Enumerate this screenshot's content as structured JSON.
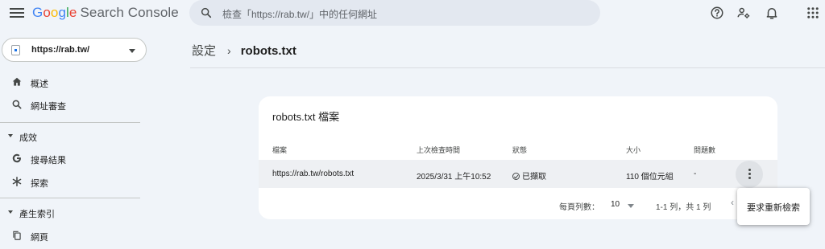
{
  "header": {
    "logo": {
      "g": "G",
      "o1": "o",
      "o2": "o",
      "g2": "g",
      "l": "l",
      "e": "e",
      "product": "Search Console"
    },
    "search_placeholder": "檢查「https://rab.tw/」中的任何網址",
    "icons": [
      "menu-icon",
      "search-icon",
      "help-icon",
      "manage-users-icon",
      "notifications-icon",
      "apps-grid-icon"
    ]
  },
  "sidebar": {
    "property": "https://rab.tw/",
    "items": [
      {
        "label": "概述",
        "icon": "home-icon"
      },
      {
        "label": "網址審查",
        "icon": "search-icon"
      }
    ],
    "sections": [
      {
        "label": "成效",
        "items": [
          {
            "label": "搜尋結果",
            "icon": "google-g-icon"
          },
          {
            "label": "探索",
            "icon": "asterisk-icon"
          }
        ]
      },
      {
        "label": "產生索引",
        "items": [
          {
            "label": "網頁",
            "icon": "pages-icon"
          }
        ]
      }
    ]
  },
  "breadcrumb": {
    "parent": "設定",
    "separator": "›",
    "current": "robots.txt"
  },
  "card": {
    "title": "robots.txt 檔案",
    "columns": [
      "檔案",
      "上次檢查時間",
      "狀態",
      "大小",
      "問題數"
    ],
    "rows": [
      {
        "file": "https://rab.tw/robots.txt",
        "checked": "2025/3/31 上午10:52",
        "status": "已擷取",
        "size": "110 個位元組",
        "issues": "-"
      }
    ],
    "pager": {
      "rows_per_page_label": "每頁列數：",
      "rows_per_page": "10",
      "range": "1-1 列，共 1 列"
    }
  },
  "popup_menu": {
    "items": [
      "要求重新檢索"
    ]
  },
  "colors": {
    "accent": "#1a73e8",
    "background": "#f0f4f9",
    "search_bg": "#e3e8f0",
    "row_bg": "#eef0f3"
  }
}
